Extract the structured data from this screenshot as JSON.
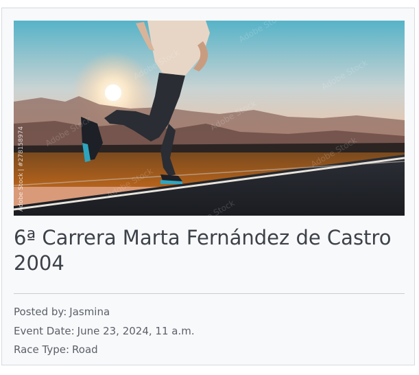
{
  "event": {
    "title": "6ª Carrera Marta Fernández de Castro 2004",
    "image_alt": "Runner on a road at sunset",
    "image_credit": "Adobe Stock | #278158974",
    "watermark": "Adobe Stock"
  },
  "meta": {
    "posted_label": "Posted by:",
    "posted_value": "Jasmina",
    "date_label": "Event Date:",
    "date_value": "June 23, 2024, 11 a.m.",
    "type_label": "Race Type:",
    "type_value": "Road"
  }
}
